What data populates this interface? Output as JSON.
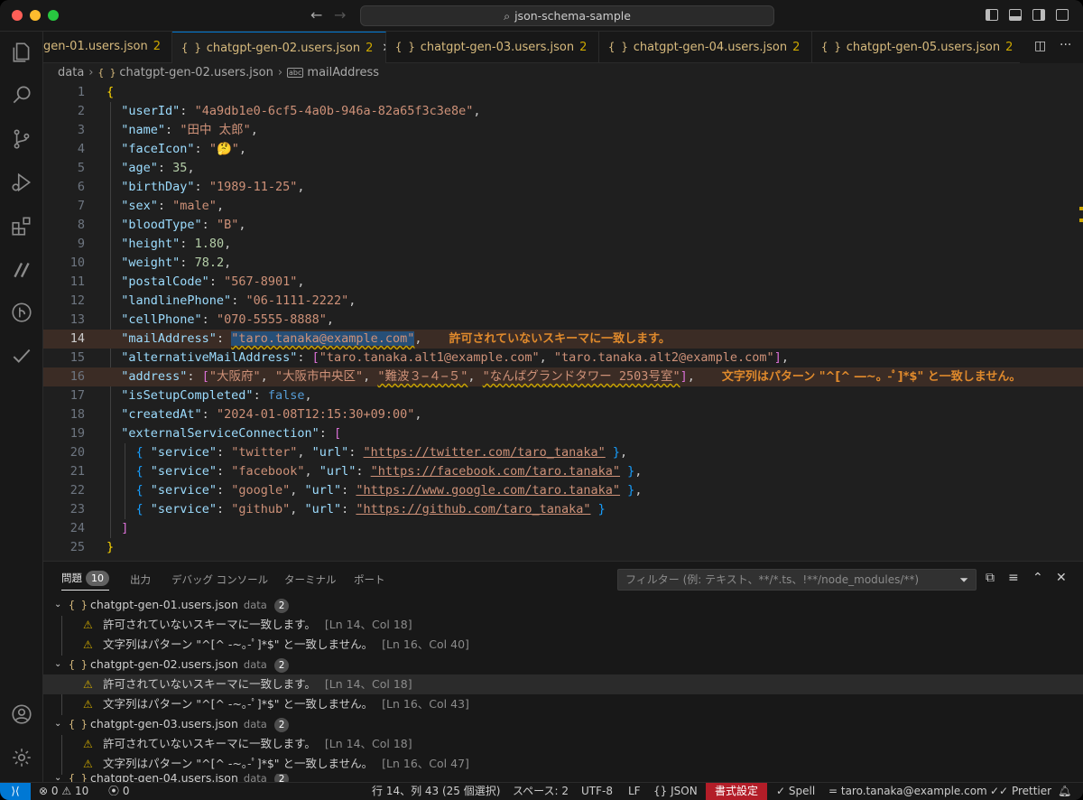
{
  "window": {
    "search_text": "json-schema-sample"
  },
  "tabs": [
    {
      "label": "gen-01.users.json",
      "count": "2"
    },
    {
      "label": "chatgpt-gen-02.users.json",
      "count": "2"
    },
    {
      "label": "chatgpt-gen-03.users.json",
      "count": "2"
    },
    {
      "label": "chatgpt-gen-04.users.json",
      "count": "2"
    },
    {
      "label": "chatgpt-gen-05.users.json",
      "count": "2"
    }
  ],
  "breadcrumb": {
    "folder": "data",
    "file": "chatgpt-gen-02.users.json",
    "symbol": "mailAddress",
    "braces": "{ }"
  },
  "editor": {
    "line_numbers": [
      "1",
      "2",
      "3",
      "4",
      "5",
      "6",
      "7",
      "8",
      "9",
      "10",
      "11",
      "12",
      "13",
      "14",
      "15",
      "16",
      "17",
      "18",
      "19",
      "20",
      "21",
      "22",
      "23",
      "24",
      "25"
    ],
    "userId": "\"4a9db1e0-6cf5-4a0b-946a-82a65f3c3e8e\"",
    "name": "\"田中 太郎\"",
    "faceIcon": "\"🤔\"",
    "age": "35",
    "birthDay": "\"1989-11-25\"",
    "sex": "\"male\"",
    "bloodType": "\"B\"",
    "height": "1.80",
    "weight": "78.2",
    "postalCode": "\"567-8901\"",
    "landlinePhone": "\"06-1111-2222\"",
    "cellPhone": "\"070-5555-8888\"",
    "mailAddress": "\"taro.tanaka@example.com\"",
    "alt1": "\"taro.tanaka.alt1@example.com\"",
    "alt2": "\"taro.tanaka.alt2@example.com\"",
    "addr1": "\"大阪府\"",
    "addr2": "\"大阪市中央区\"",
    "addr3": "\"難波３−４−５\"",
    "addr4": "\"なんばグランドタワー 2503号室\"",
    "isSetupCompleted": "false",
    "createdAt": "\"2024-01-08T12:15:30+09:00\"",
    "services": [
      {
        "service": "\"twitter\"",
        "url": "\"https://twitter.com/taro_tanaka\""
      },
      {
        "service": "\"facebook\"",
        "url": "\"https://facebook.com/taro.tanaka\""
      },
      {
        "service": "\"google\"",
        "url": "\"https://www.google.com/taro.tanaka\""
      },
      {
        "service": "\"github\"",
        "url": "\"https://github.com/taro_tanaka\""
      }
    ],
    "diag14": "許可されていないスキーマに一致します。",
    "diag16": "文字列はパターン \"^[^ ―~。-ﾟ]*$\" と一致しません。"
  },
  "panel": {
    "tabs": [
      "問題",
      "出力",
      "デバッグ コンソール",
      "ターミナル",
      "ポート"
    ],
    "problem_count": "10",
    "filter_placeholder": "フィルター (例: テキスト、**/*.ts、!**/node_modules/**)",
    "groups": [
      {
        "file": "chatgpt-gen-01.users.json",
        "dir": "data",
        "count": "2",
        "items": [
          {
            "msg": "許可されていないスキーマに一致します。",
            "loc": "[Ln 14、Col 18]"
          },
          {
            "msg": "文字列はパターン \"^[^ -~｡-ﾟ]*$\" と一致しません。",
            "loc": "[Ln 16、Col 40]"
          }
        ]
      },
      {
        "file": "chatgpt-gen-02.users.json",
        "dir": "data",
        "count": "2",
        "items": [
          {
            "msg": "許可されていないスキーマに一致します。",
            "loc": "[Ln 14、Col 18]"
          },
          {
            "msg": "文字列はパターン \"^[^ -~｡-ﾟ]*$\" と一致しません。",
            "loc": "[Ln 16、Col 43]"
          }
        ]
      },
      {
        "file": "chatgpt-gen-03.users.json",
        "dir": "data",
        "count": "2",
        "items": [
          {
            "msg": "許可されていないスキーマに一致します。",
            "loc": "[Ln 14、Col 18]"
          },
          {
            "msg": "文字列はパターン \"^[^ -~｡-ﾟ]*$\" と一致しません。",
            "loc": "[Ln 16、Col 47]"
          }
        ]
      },
      {
        "file": "chatgpt-gen-04.users.json",
        "dir": "data",
        "count": "2",
        "items": []
      }
    ]
  },
  "status": {
    "errors": "0",
    "warnings": "10",
    "ports": "0",
    "position": "行 14、列 43 (25 個選択)",
    "spaces": "スペース: 2",
    "encoding": "UTF-8",
    "eol": "LF",
    "language": "JSON",
    "format": "書式設定",
    "spell": "Spell",
    "spell_word": "= taro.tanaka@example.com",
    "prettier": "Prettier"
  },
  "colors": {
    "accent": "#0078d4",
    "warning": "#cca700",
    "format_bg": "#b31d28"
  }
}
